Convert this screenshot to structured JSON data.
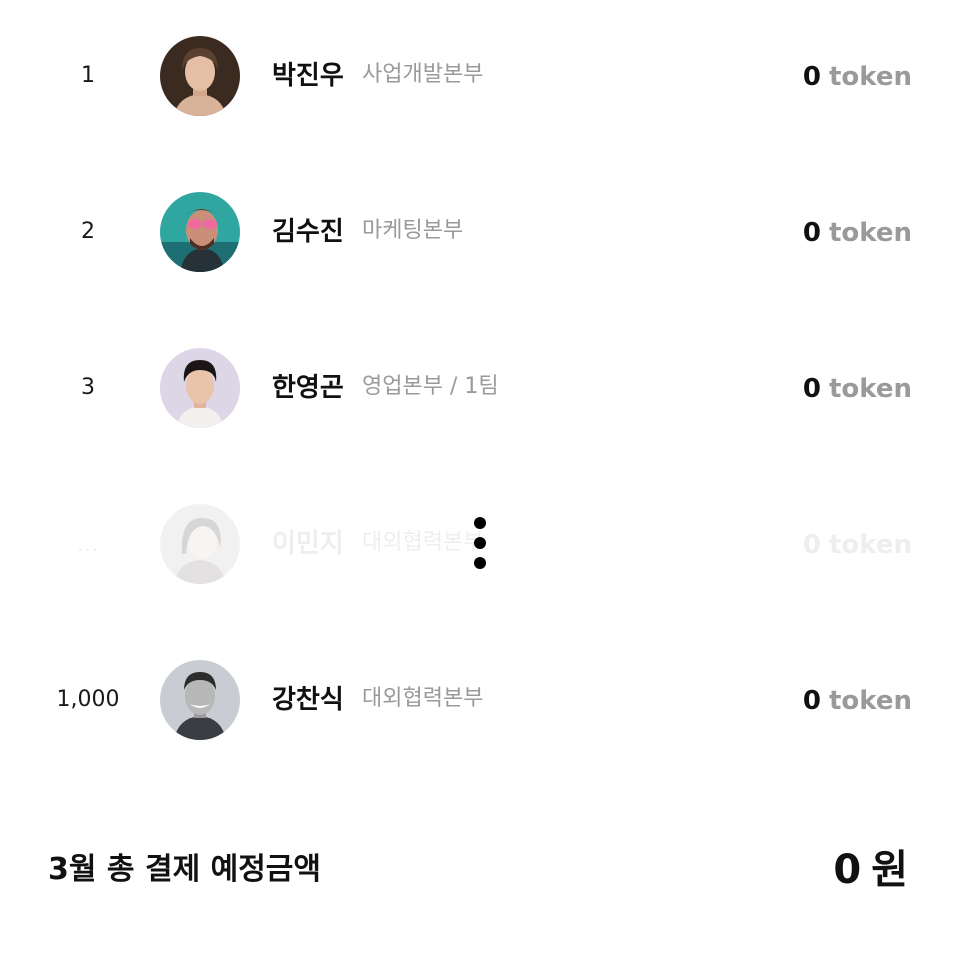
{
  "ranking": {
    "rows": [
      {
        "rank": "1",
        "name": "박진우",
        "department": "사업개발본부",
        "amount": "0",
        "unit": "token",
        "avatar_icon": "user-avatar-photo"
      },
      {
        "rank": "2",
        "name": "김수진",
        "department": "마케팅본부",
        "amount": "0",
        "unit": "token",
        "avatar_icon": "user-avatar-photo"
      },
      {
        "rank": "3",
        "name": "한영곤",
        "department": "영업본부 / 1팀",
        "amount": "0",
        "unit": "token",
        "avatar_icon": "user-avatar-photo"
      },
      {
        "rank": "...",
        "name": "이민지",
        "department": "대외협력본부",
        "amount": "0",
        "unit": "token",
        "avatar_icon": "user-avatar-photo"
      },
      {
        "rank": "1,000",
        "name": "강찬식",
        "department": "대외협력본부",
        "amount": "0",
        "unit": "token",
        "avatar_icon": "user-avatar-photo"
      }
    ],
    "more_icon": "vertical-ellipsis-icon"
  },
  "summary": {
    "label": "3월 총 결제 예정금액",
    "amount": "0",
    "currency": "원"
  },
  "colors": {
    "text_primary": "#111111",
    "text_secondary": "#9a9a9a",
    "text_faded": "#eeeeee"
  }
}
